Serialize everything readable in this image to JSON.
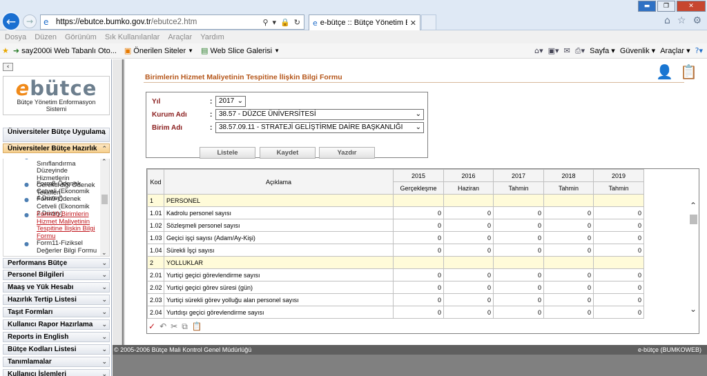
{
  "browser": {
    "url_host": "https://ebutce.bumko.gov.tr",
    "url_path": "/ebutce2.htm",
    "tab_title": "e-bütçe :: Bütçe Yönetim E...",
    "menu": [
      "Dosya",
      "Düzen",
      "Görünüm",
      "Sık Kullanılanlar",
      "Araçlar",
      "Yardım"
    ],
    "favorites": [
      {
        "label": "say2000i Web Tabanlı Oto...",
        "icon": "star-icon"
      },
      {
        "label": "Önerilen Siteler",
        "icon": "suggested-sites-icon"
      },
      {
        "label": "Web Slice Galerisi",
        "icon": "web-slice-icon"
      }
    ],
    "commands": {
      "page": "Sayfa",
      "safety": "Güvenlik",
      "tools": "Araçlar"
    }
  },
  "sidebar": {
    "logo": {
      "prefix": "e",
      "word": "bütce",
      "subtitle_line1": "Bütçe Yönetim Enformasyon",
      "subtitle_line2": "Sistemi"
    },
    "sections": [
      {
        "label": "Üniversiteler Bütçe Uygulama"
      },
      {
        "label": "Üniversiteler Bütçe Hazırlık"
      },
      {
        "label": "Performans Bütçe"
      },
      {
        "label": "Personel Bilgileri"
      },
      {
        "label": "Maaş ve Yük Hesabı"
      },
      {
        "label": "Hazırlık Tertip Listesi"
      },
      {
        "label": "Taşıt Formları"
      },
      {
        "label": "Kullanıcı Rapor Hazırlama"
      },
      {
        "label": "Reports in English"
      },
      {
        "label": "Bütçe Kodları Listesi"
      },
      {
        "label": "Tanımlamalar"
      },
      {
        "label": "Kullanıcı İşlemleri"
      }
    ],
    "subitems": [
      {
        "label": "Ekonomik Sınıflandırma Düzeyinde Hizmetlerin Gerektirdiği Ödenek Teklifleri"
      },
      {
        "label": "Form8-Ödenek Cetveli (Ekonomik 4.Düzey)"
      },
      {
        "label": "Form9-Ödenek Cetveli (Ekonomik 2.Düzey)"
      },
      {
        "label": "Form10-Birimlerin Hizmet Maliyetinin Tespitine İlişkin Bilgi Formu"
      },
      {
        "label": "Form11-Fiziksel Değerler Bilgi Formu"
      }
    ]
  },
  "page": {
    "title": "Birimlerin Hizmet Maliyetinin Tespitine İlişkin Bilgi Formu",
    "filters": {
      "year_label": "Yıl",
      "year_value": "2017",
      "kurum_label": "Kurum Adı",
      "kurum_value": "38.57 - DÜZCE ÜNİVERSİTESİ",
      "birim_label": "Birim Adı",
      "birim_value": "38.57.09.11 - STRATEJİ GELİŞTİRME DAİRE BAŞKANLIĞI"
    },
    "buttons": {
      "list": "Listele",
      "save": "Kaydet",
      "print": "Yazdır"
    }
  },
  "grid": {
    "headers": {
      "kod": "Kod",
      "aciklama": "Açıklama"
    },
    "years": [
      "2015",
      "2016",
      "2017",
      "2018",
      "2019"
    ],
    "subheaders": [
      "Gerçekleşme",
      "Haziran",
      "Tahmin",
      "Tahmin",
      "Tahmin"
    ],
    "rows": [
      {
        "kod": "1",
        "text": "PERSONEL",
        "group": true,
        "values": [
          "",
          "",
          "",
          "",
          ""
        ]
      },
      {
        "kod": "1.01",
        "text": "Kadrolu personel sayısı",
        "group": false,
        "values": [
          "0",
          "0",
          "0",
          "0",
          "0"
        ]
      },
      {
        "kod": "1.02",
        "text": "Sözleşmeli personel sayısı",
        "group": false,
        "values": [
          "0",
          "0",
          "0",
          "0",
          "0"
        ]
      },
      {
        "kod": "1.03",
        "text": "Geçici işçi sayısı (Adam/Ay-Kişi)",
        "group": false,
        "values": [
          "0",
          "0",
          "0",
          "0",
          "0"
        ]
      },
      {
        "kod": "1.04",
        "text": "Sürekli İşçi sayısı",
        "group": false,
        "values": [
          "0",
          "0",
          "0",
          "0",
          "0"
        ]
      },
      {
        "kod": "2",
        "text": "YOLLUKLAR",
        "group": true,
        "values": [
          "",
          "",
          "",
          "",
          ""
        ]
      },
      {
        "kod": "2.01",
        "text": "Yurtiçi geçici görevlendirme sayısı",
        "group": false,
        "values": [
          "0",
          "0",
          "0",
          "0",
          "0"
        ]
      },
      {
        "kod": "2.02",
        "text": "Yurtiçi geçici görev süresi (gün)",
        "group": false,
        "values": [
          "0",
          "0",
          "0",
          "0",
          "0"
        ]
      },
      {
        "kod": "2.03",
        "text": "Yurtiçi sürekli görev yolluğu alan personel sayısı",
        "group": false,
        "values": [
          "0",
          "0",
          "0",
          "0",
          "0"
        ]
      },
      {
        "kod": "2.04",
        "text": "Yurtdışı geçici görevlendirme sayısı",
        "group": false,
        "values": [
          "0",
          "0",
          "0",
          "0",
          "0"
        ]
      }
    ]
  },
  "footer": {
    "left": "© 2005-2006 Bütçe Mali Kontrol Genel Müdürlüğü",
    "right": "e-bütçe (BUMKOWEB)"
  }
}
